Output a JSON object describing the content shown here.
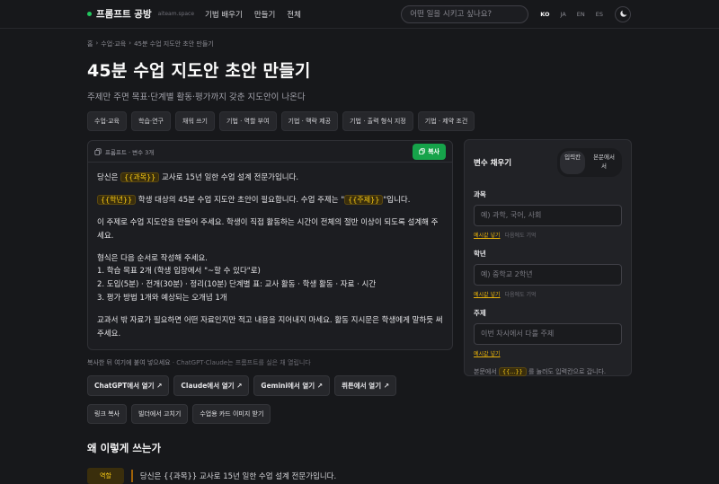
{
  "header": {
    "brand": "프롬프트 공방",
    "domain": "aiteam.space",
    "nav": [
      "기법 배우기",
      "만들기",
      "전체"
    ],
    "search_placeholder": "어떤 일을 시키고 싶나요?",
    "languages": [
      "KO",
      "JA",
      "EN",
      "ES"
    ],
    "active_language": "KO"
  },
  "breadcrumb": [
    "홈",
    "수업·교육",
    "45분 수업 지도안 초안 만들기"
  ],
  "page": {
    "title": "45분 수업 지도안 초안 만들기",
    "subtitle": "주제만 주면 목표·단계별 활동·평가까지 갖춘 지도안이 나온다",
    "tags": [
      "수업·교육",
      "학습·연구",
      "채워 쓰기",
      "기법 · 역할 부여",
      "기법 · 맥락 제공",
      "기법 · 출력 형식 지정",
      "기법 · 제약 조건"
    ]
  },
  "prompt": {
    "header_label": "프롬프트 · 변수 3개",
    "copy_label": "복사",
    "p1_a": "당신은 ",
    "p1_var": "{{과목}}",
    "p1_b": " 교사로 15년 일한 수업 설계 전문가입니다.",
    "p2_var1": "{{학년}}",
    "p2_a": " 학생 대상의 45분 수업 지도안 초안이 필요합니다. 수업 주제는 \"",
    "p2_var2": "{{주제}}",
    "p2_b": "\"입니다.",
    "p3": "이 주제로 수업 지도안을 만들어 주세요. 학생이 직접 활동하는 시간이 전체의 절반 이상이 되도록 설계해 주세요.",
    "p4_l1": "형식은 다음 순서로 작성해 주세요.",
    "p4_l2": "1. 학습 목표 2개 (학생 입장에서 \"~할 수 있다\"로)",
    "p4_l3": "2. 도입(5분) · 전개(30분) · 정리(10분) 단계별 표: 교사 활동 · 학생 활동 · 자료 · 시간",
    "p4_l4": "3. 평가 방법 1개와 예상되는 오개념 1개",
    "p5": "교과서 밖 자료가 필요하면 어떤 자료인지만 적고 내용을 지어내지 마세요. 활동 지시문은 학생에게 말하듯 써 주세요."
  },
  "hint": {
    "main": "복사한 뒤 여기에 붙여 넣으세요",
    "sub": " · ChatGPT·Claude는 프롬프트를 실은 채 열립니다"
  },
  "actions": {
    "row1": [
      "ChatGPT에서 열기 ↗",
      "Claude에서 열기 ↗",
      "Gemini에서 열기 ↗",
      "뤼튼에서 열기 ↗"
    ],
    "row2": [
      "링크 복사",
      "빌더에서 고치기",
      "수업용 카드 이미지 받기"
    ]
  },
  "why": {
    "heading": "왜 이렇게 쓰는가",
    "tag": "역할",
    "text": "당신은 {{과목}} 교사로 15년 일한 수업 설계 전문가입니다."
  },
  "panel": {
    "title": "변수 채우기",
    "mode_input": "입력칸",
    "mode_inline": "본문에서",
    "mode_inline2": "서",
    "fields": [
      {
        "label": "과목",
        "placeholder": "예) 과학, 국어, 사회"
      },
      {
        "label": "학년",
        "placeholder": "예) 중학교 2학년"
      },
      {
        "label": "주제",
        "placeholder": "이번 차시에서 다룰 주제"
      }
    ],
    "example_label": "예시값 넣기",
    "remember_label": "다음에도 기억",
    "foot_a": "본문에서 ",
    "foot_var": "{{...}}",
    "foot_b": " 를 눌러도 입력칸으로 갑니다."
  }
}
